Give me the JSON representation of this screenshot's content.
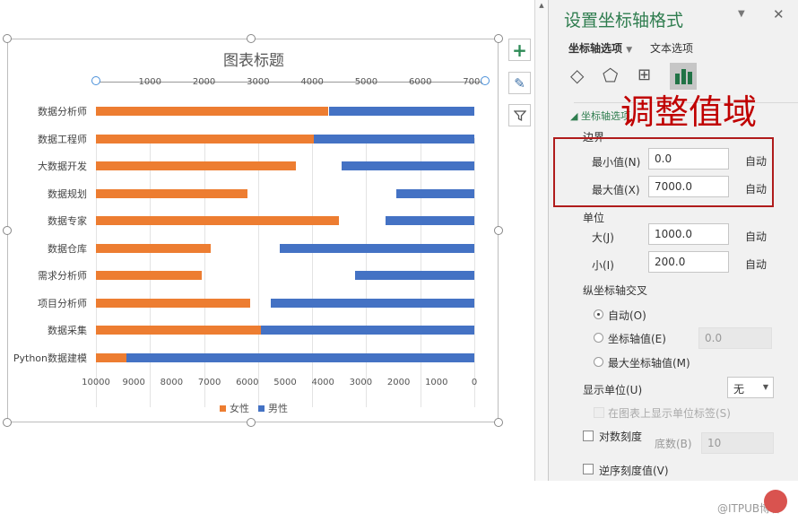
{
  "chart": {
    "title": "图表标题",
    "legend": [
      {
        "label": "女性",
        "color": "#ED7D31"
      },
      {
        "label": "男性",
        "color": "#4472C4"
      }
    ],
    "side_buttons": [
      "plus-icon",
      "brush-icon",
      "filter-icon"
    ]
  },
  "chart_data": {
    "type": "bar",
    "orientation": "horizontal",
    "title": "图表标题",
    "categories": [
      "数据分析师",
      "数据工程师",
      "大数据开发",
      "数据规划",
      "数据专家",
      "数据仓库",
      "需求分析师",
      "项目分析师",
      "数据采集",
      "Python数据建模"
    ],
    "series": [
      {
        "name": "女性",
        "color": "#ED7D31",
        "axis": "top",
        "values": [
          4300,
          4030,
          3700,
          2800,
          4500,
          2120,
          1960,
          2850,
          3050,
          560
        ]
      },
      {
        "name": "男性",
        "color": "#4472C4",
        "axis": "bottom-reversed",
        "values": [
          3840,
          4240,
          3510,
          2060,
          2340,
          5140,
          3150,
          5380,
          5640,
          9190
        ]
      }
    ],
    "top_axis": {
      "range": [
        0,
        7000
      ],
      "ticks": [
        "0",
        "1000",
        "2000",
        "3000",
        "4000",
        "5000",
        "6000",
        "7000"
      ]
    },
    "bottom_axis": {
      "range": [
        10000,
        0
      ],
      "ticks": [
        "10000",
        "9000",
        "8000",
        "7000",
        "6000",
        "5000",
        "4000",
        "3000",
        "2000",
        "1000",
        "0"
      ]
    },
    "legend_position": "bottom",
    "grid": true
  },
  "panel": {
    "title": "设置坐标轴格式",
    "tab_axis": "坐标轴选项",
    "tab_text": "文本选项",
    "section": "坐标轴选项",
    "annotation": "调整值域",
    "bounds_label": "边界",
    "min_label": "最小值(N)",
    "min_value": "0.0",
    "min_auto": "自动",
    "max_label": "最大值(X)",
    "max_value": "7000.0",
    "max_auto": "自动",
    "units_label": "单位",
    "major_label": "大(J)",
    "major_value": "1000.0",
    "major_auto": "自动",
    "minor_label": "小(I)",
    "minor_value": "200.0",
    "minor_auto": "自动",
    "cross_label": "纵坐标轴交叉",
    "radio_auto": "自动(O)",
    "radio_value": "坐标轴值(E)",
    "radio_value_input": "0.0",
    "radio_max": "最大坐标轴值(M)",
    "display_units_label": "显示单位(U)",
    "display_units_value": "无",
    "show_units_label": "在图表上显示单位标签(S)",
    "log_label": "对数刻度",
    "base_label": "底数(B)",
    "base_value": "10",
    "reverse_label": "逆序刻度值(V)"
  },
  "watermark": "@ITPUB博客"
}
